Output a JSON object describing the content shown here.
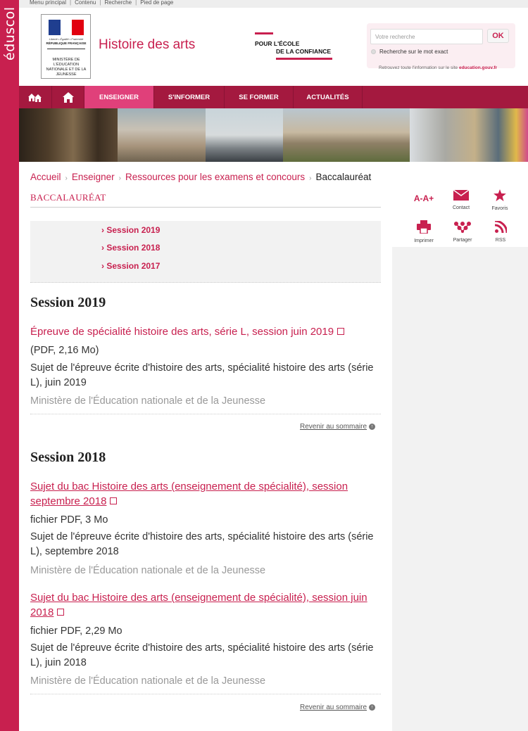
{
  "brand": {
    "side_label": "éduscol",
    "site_title": "Histoire des arts"
  },
  "topbar": {
    "links": [
      "Menu principal",
      "Contenu",
      "Recherche",
      "Pied de page"
    ]
  },
  "logo": {
    "motto": "Liberté • Égalité • Fraternité",
    "republic": "RÉPUBLIQUE FRANÇAISE",
    "ministry": "MINISTÈRE DE L'ÉDUCATION NATIONALE ET DE LA JEUNESSE",
    "flag_colors": [
      "#1f3e8f",
      "#ffffff",
      "#e1000f"
    ]
  },
  "ecole_logo": {
    "line1": "POUR L'ÉCOLE",
    "line2": "DE LA CONFIANCE"
  },
  "search": {
    "placeholder": "Votre recherche",
    "ok_label": "OK",
    "exact_label": "Recherche sur le mot exact",
    "info_prefix": "Retrouvez toute l'information sur le site",
    "info_link": "education.gouv.fr"
  },
  "nav": {
    "icons": [
      "home-network-icon",
      "home-icon"
    ],
    "items": [
      "ENSEIGNER",
      "S'INFORMER",
      "SE FORMER",
      "ACTUALITÉS"
    ],
    "active_index": 0
  },
  "breadcrumb": [
    "Accueil",
    "Enseigner",
    "Ressources pour les examens et concours",
    "Baccalauréat"
  ],
  "page": {
    "title": "BACCALAURÉAT"
  },
  "toc": [
    "Session 2019",
    "Session 2018",
    "Session 2017"
  ],
  "tools": [
    {
      "label": "",
      "icon": "text-size-icon",
      "glyph": "A-A+"
    },
    {
      "label": "Contact",
      "icon": "mail-icon"
    },
    {
      "label": "Favoris",
      "icon": "star-icon"
    },
    {
      "label": "Imprimer",
      "icon": "print-icon"
    },
    {
      "label": "Partager",
      "icon": "share-icon"
    },
    {
      "label": "RSS",
      "icon": "rss-icon"
    }
  ],
  "sections": [
    {
      "heading": "Session 2019",
      "docs": [
        {
          "title": "Épreuve de spécialité histoire des arts, série L, session juin 2019",
          "meta": "(PDF, 2,16 Mo)",
          "desc": "Sujet de l'épreuve écrite d'histoire des arts, spécialité histoire des arts (série L), juin 2019",
          "source": "Ministère de l'Éducation nationale et de la Jeunesse"
        }
      ],
      "back": "Revenir au sommaire"
    },
    {
      "heading": "Session 2018",
      "docs": [
        {
          "title": "Sujet du bac Histoire des arts (enseignement de spécialité), session septembre 2018",
          "meta": "fichier PDF, 3 Mo",
          "desc": "Sujet de l'épreuve écrite d'histoire des arts, spécialité histoire des arts (série L), septembre 2018",
          "source": "Ministère de l'Éducation nationale et de la Jeunesse"
        },
        {
          "title": "Sujet du bac Histoire des arts (enseignement de spécialité), session juin 2018",
          "meta": "fichier PDF, 2,29 Mo",
          "desc": "Sujet de l'épreuve écrite d'histoire des arts, spécialité histoire des arts (série L), juin 2018",
          "source": "Ministère de l'Éducation nationale et de la Jeunesse"
        }
      ],
      "back": "Revenir au sommaire"
    }
  ],
  "colors": {
    "brand": "#c8204f",
    "nav": "#a4193f",
    "nav_active": "#e0407a"
  }
}
